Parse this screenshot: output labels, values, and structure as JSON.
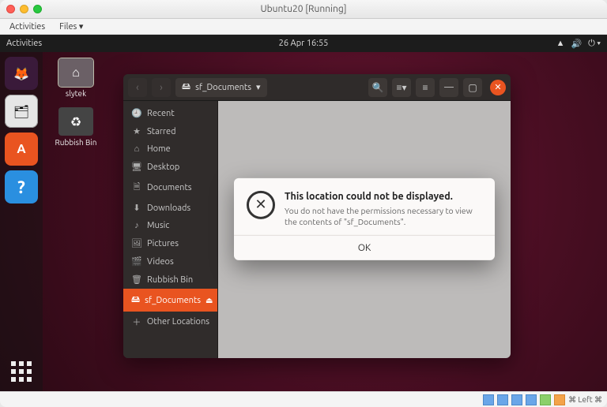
{
  "host": {
    "title": "Ubuntu20 [Running]",
    "menubar": {
      "activities": "Activities",
      "files": "Files ▾"
    },
    "status_right": "⌘ Left ⌘"
  },
  "gnome": {
    "activities": "Activities",
    "datetime": "26 Apr  16:55",
    "tray": {
      "net": "▲",
      "vol": "🔊",
      "power": "⏻ ▾"
    }
  },
  "desktop": {
    "icons": [
      {
        "name": "slytek",
        "glyph": "⌂"
      },
      {
        "name": "Rubbish Bin",
        "glyph": "♻"
      }
    ]
  },
  "dock": {
    "firefox_glyph": "🦊",
    "files_glyph": "🗂",
    "software_glyph": "A",
    "help_glyph": "?"
  },
  "nautilus": {
    "breadcrumb_icon": "🖴",
    "breadcrumb": "sf_Documents",
    "breadcrumb_caret": "▾",
    "nav_back": "‹",
    "nav_fwd": "›",
    "toolbar": {
      "search": "🔍",
      "view": "≡▾",
      "menu": "≡",
      "min": "—",
      "max": "▢",
      "close": "✕"
    },
    "sidebar": [
      {
        "icon": "🕘",
        "label": "Recent"
      },
      {
        "icon": "★",
        "label": "Starred"
      },
      {
        "icon": "⌂",
        "label": "Home"
      },
      {
        "icon": "🖥",
        "label": "Desktop"
      },
      {
        "icon": "🗎",
        "label": "Documents"
      },
      {
        "icon": "⬇",
        "label": "Downloads"
      },
      {
        "icon": "♪",
        "label": "Music"
      },
      {
        "icon": "🖼",
        "label": "Pictures"
      },
      {
        "icon": "🎬",
        "label": "Videos"
      },
      {
        "icon": "🗑",
        "label": "Rubbish Bin"
      },
      {
        "icon": "🖴",
        "label": "sf_Documents",
        "active": true,
        "eject": "⏏"
      },
      {
        "icon": "＋",
        "label": "Other Locations"
      }
    ]
  },
  "dialog": {
    "icon": "✕",
    "title": "This location could not be displayed.",
    "message": "You do not have the permissions necessary to view the contents of \"sf_Documents\".",
    "ok": "OK"
  }
}
